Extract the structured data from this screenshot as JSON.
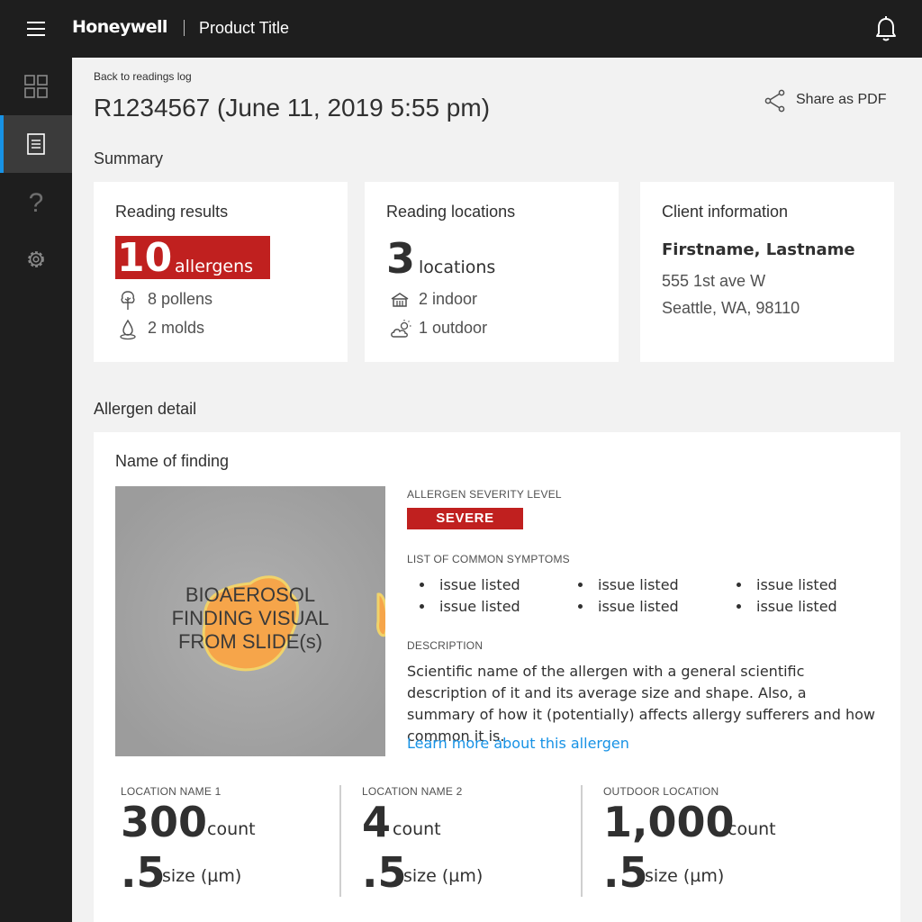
{
  "header": {
    "brand": "Honeywell",
    "product_title": "Product Title"
  },
  "sidebar": {
    "items": [
      {
        "name": "dashboard",
        "icon": "grid-icon",
        "active": false
      },
      {
        "name": "readings",
        "icon": "document-icon",
        "active": true
      },
      {
        "name": "help",
        "icon": "help-icon",
        "active": false
      },
      {
        "name": "settings",
        "icon": "gear-icon",
        "active": false
      }
    ]
  },
  "page": {
    "back_link": "Back to readings log",
    "title": "R1234567 (June 11, 2019 5:55 pm)",
    "share_label": "Share as PDF"
  },
  "summary": {
    "section_title": "Summary",
    "reading_results": {
      "title": "Reading results",
      "count": "10",
      "count_unit": "allergens",
      "pollens": "8 pollens",
      "molds": "2 molds"
    },
    "reading_locations": {
      "title": "Reading locations",
      "count": "3",
      "count_unit": "locations",
      "indoor": "2 indoor",
      "outdoor": "1 outdoor"
    },
    "client_information": {
      "title": "Client information",
      "name": "Firstname, Lastname",
      "address_line1": "555 1st ave W",
      "address_line2": "Seattle, WA, 98110"
    }
  },
  "allergen_detail": {
    "section_title": "Allergen detail",
    "finding_title": "Name of finding",
    "image_placeholder": [
      "BIOAEROSOL",
      "FINDING VISUAL",
      "FROM SLIDE(s)"
    ],
    "severity_label": "ALLERGEN SEVERITY LEVEL",
    "severity_value": "SEVERE",
    "symptoms_label": "LIST OF COMMON SYMPTOMS",
    "symptoms": [
      "issue listed",
      "issue listed",
      "issue listed",
      "issue listed",
      "issue listed",
      "issue listed"
    ],
    "description_label": "DESCRIPTION",
    "description": "Scientific name of the allergen with a general scientific description of it and its average size and shape. Also, a summary of how it (potentially) affects allergy sufferers and how common it is.",
    "learn_more": "Learn more about this allergen",
    "locations": [
      {
        "label": "LOCATION NAME 1",
        "count": "300",
        "count_unit": "count",
        "size": ".5",
        "size_unit": "size (µm)"
      },
      {
        "label": "LOCATION NAME 2",
        "count": "4",
        "count_unit": "count",
        "size": ".5",
        "size_unit": "size (µm)"
      },
      {
        "label": "OUTDOOR LOCATION",
        "count": "1,000",
        "count_unit": "count",
        "size": ".5",
        "size_unit": "size (µm)"
      }
    ]
  },
  "colors": {
    "topbar": "#1e1e1e",
    "accent_blue": "#1792e5",
    "severe_red": "#c0201f",
    "page_bg": "#f2f2f2"
  }
}
